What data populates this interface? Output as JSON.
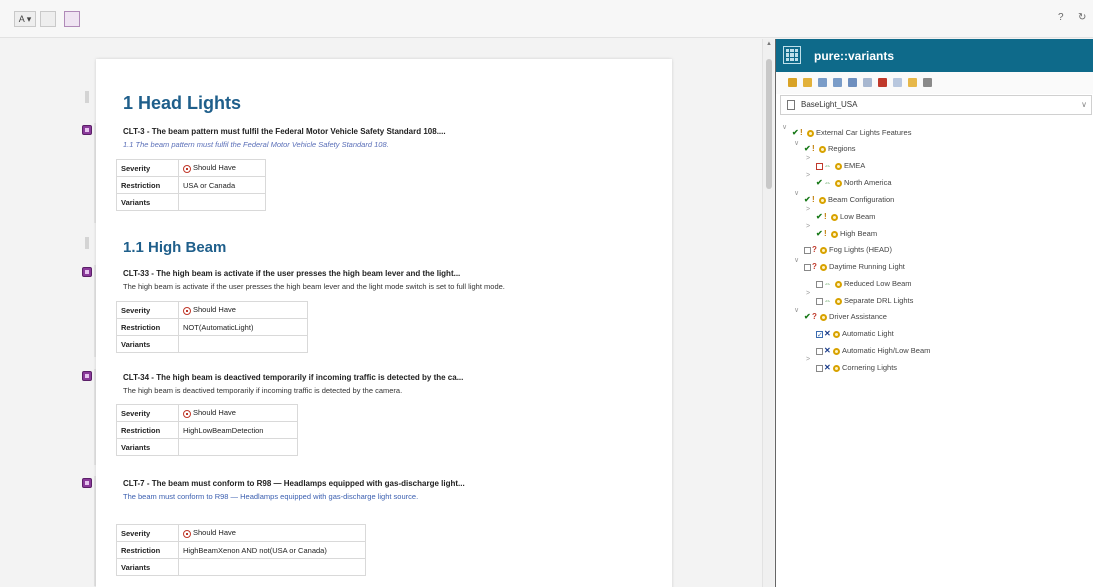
{
  "toolbar": {
    "font_button": "A ▾",
    "help_label": "?",
    "refresh_label": "↻"
  },
  "document": {
    "h1": "1 Head Lights",
    "h2": "1.1 High Beam",
    "requirements": [
      {
        "title": "CLT-3 - The beam pattern must fulfil the Federal Motor Vehicle Safety Standard 108....",
        "desc": "1.1 The beam pattern must fulfil the Federal Motor Vehicle Safety Standard 108.",
        "severity": "Should Have",
        "restriction": "USA or Canada",
        "variants": ""
      },
      {
        "title": "CLT-33 - The high beam is activate if the user presses the high beam lever and the light...",
        "desc": "The high beam is activate if the user presses the high beam lever and the light mode switch is set to full light mode.",
        "severity": "Should Have",
        "restriction": "NOT(AutomaticLight)",
        "variants": ""
      },
      {
        "title": "CLT-34 - The high beam is deactived temporarily if incoming traffic is detected by the ca...",
        "desc": "The high beam is deactived temporarily if incoming traffic is detected by the camera.",
        "severity": "Should Have",
        "restriction": "HighLowBeamDetection",
        "variants": ""
      },
      {
        "title": "CLT-7 - The beam must conform to R98 — Headlamps equipped with gas-discharge light...",
        "desc": "The beam must conform to R98 — Headlamps equipped with gas-discharge light source.",
        "severity": "Should Have",
        "restriction": "HighBeamXenon AND not(USA or Canada)",
        "variants": ""
      }
    ],
    "labels": {
      "severity": "Severity",
      "restriction": "Restriction",
      "variants": "Variants"
    }
  },
  "panel": {
    "title": "pure::variants",
    "selected_model": "BaseLight_USA",
    "tree": [
      {
        "label": "External Car Lights Features",
        "state": "check",
        "mark": "bang"
      },
      {
        "label": "Regions",
        "state": "check",
        "mark": "bang"
      },
      {
        "label": "EMEA",
        "state": "box-red",
        "mark": "arrows"
      },
      {
        "label": "North America",
        "state": "check",
        "mark": "arrows"
      },
      {
        "label": "Beam Configuration",
        "state": "check",
        "mark": "bang"
      },
      {
        "label": "Low Beam",
        "state": "check",
        "mark": "bang"
      },
      {
        "label": "High Beam",
        "state": "check",
        "mark": "bang"
      },
      {
        "label": "Fog Lights (HEAD)",
        "state": "box",
        "mark": "q"
      },
      {
        "label": "Daytime Running Light",
        "state": "box",
        "mark": "q"
      },
      {
        "label": "Reduced Low Beam",
        "state": "box",
        "mark": "arrows"
      },
      {
        "label": "Separate DRL Lights",
        "state": "box",
        "mark": "arrows"
      },
      {
        "label": "Driver Assistance",
        "state": "check",
        "mark": "q"
      },
      {
        "label": "Automatic Light",
        "state": "box-checked",
        "mark": "x"
      },
      {
        "label": "Automatic High/Low Beam",
        "state": "box",
        "mark": "x"
      },
      {
        "label": "Cornering Lights",
        "state": "box",
        "mark": "x"
      }
    ]
  }
}
